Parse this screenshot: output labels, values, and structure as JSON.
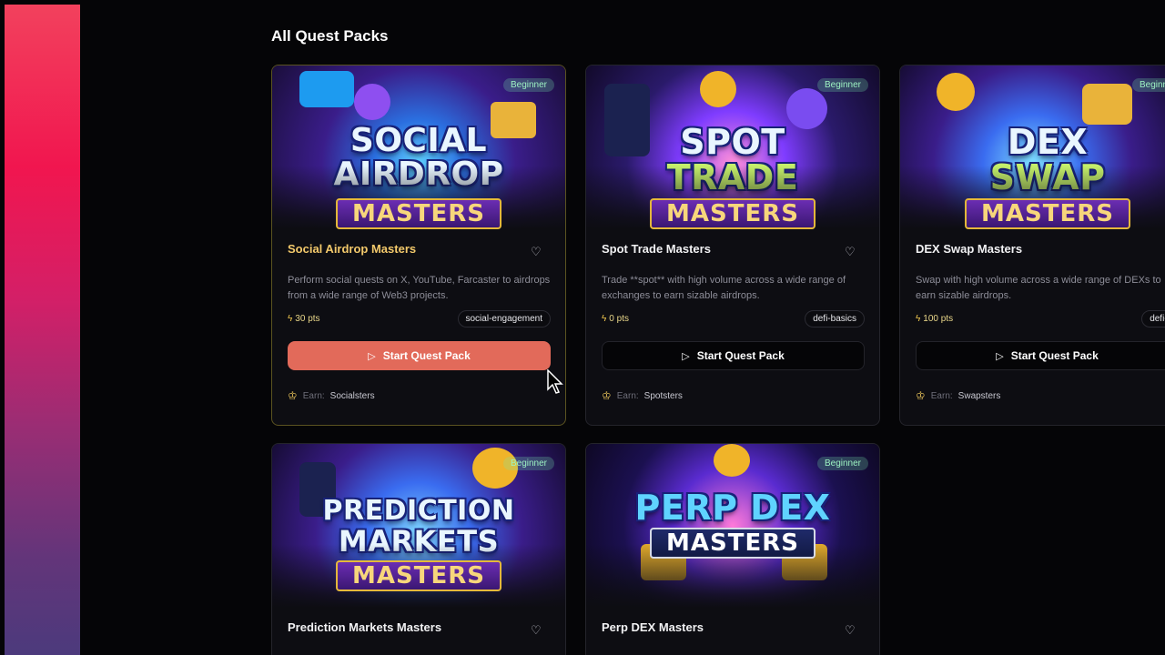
{
  "section": {
    "title": "All Quest Packs"
  },
  "cards": [
    {
      "art_line1": "SOCIAL",
      "art_line2": "AIRDROP",
      "art_sub": "MASTERS",
      "badge": "Beginner",
      "title": "Social Airdrop Masters",
      "description": "Perform social quests on X, YouTube, Farcaster to airdrops from a wide range of Web3 projects.",
      "points": "30 pts",
      "tag": "social-engagement",
      "button": "Start Quest Pack",
      "earn_label": "Earn:",
      "earn_name": "Socialsters"
    },
    {
      "art_line1": "SPOT",
      "art_line2": "TRADE",
      "art_sub": "MASTERS",
      "badge": "Beginner",
      "title": "Spot Trade Masters",
      "description": "Trade **spot** with high volume across a wide range of exchanges to earn sizable airdrops.",
      "points": "0 pts",
      "tag": "defi-basics",
      "button": "Start Quest Pack",
      "earn_label": "Earn:",
      "earn_name": "Spotsters"
    },
    {
      "art_line1": "DEX",
      "art_line2": "SWAP",
      "art_sub": "MASTERS",
      "badge": "Beginner",
      "title": "DEX Swap Masters",
      "description": "Swap with high volume across a wide range of DEXs to earn sizable airdrops.",
      "points": "100 pts",
      "tag": "defi-basics",
      "button": "Start Quest Pack",
      "earn_label": "Earn:",
      "earn_name": "Swapsters"
    },
    {
      "art_line1": "PREDICTION",
      "art_line2": "MARKETS",
      "art_sub": "MASTERS",
      "badge": "Beginner",
      "title": "Prediction Markets Masters"
    },
    {
      "art_line1": "PERP DEX",
      "art_sub": "MASTERS",
      "badge": "Beginner",
      "title": "Perp DEX Masters"
    }
  ],
  "colors": {
    "accent_button": "#e26a5a",
    "active_title": "#f3c96b",
    "background": "#050507",
    "card": "#0d0d12",
    "badge_text": "#9df2c2"
  },
  "icons": {
    "favorite": "heart-icon",
    "points": "lightning-icon",
    "button": "play-icon",
    "earn": "medal-icon",
    "pointer": "mouse-cursor-icon"
  }
}
